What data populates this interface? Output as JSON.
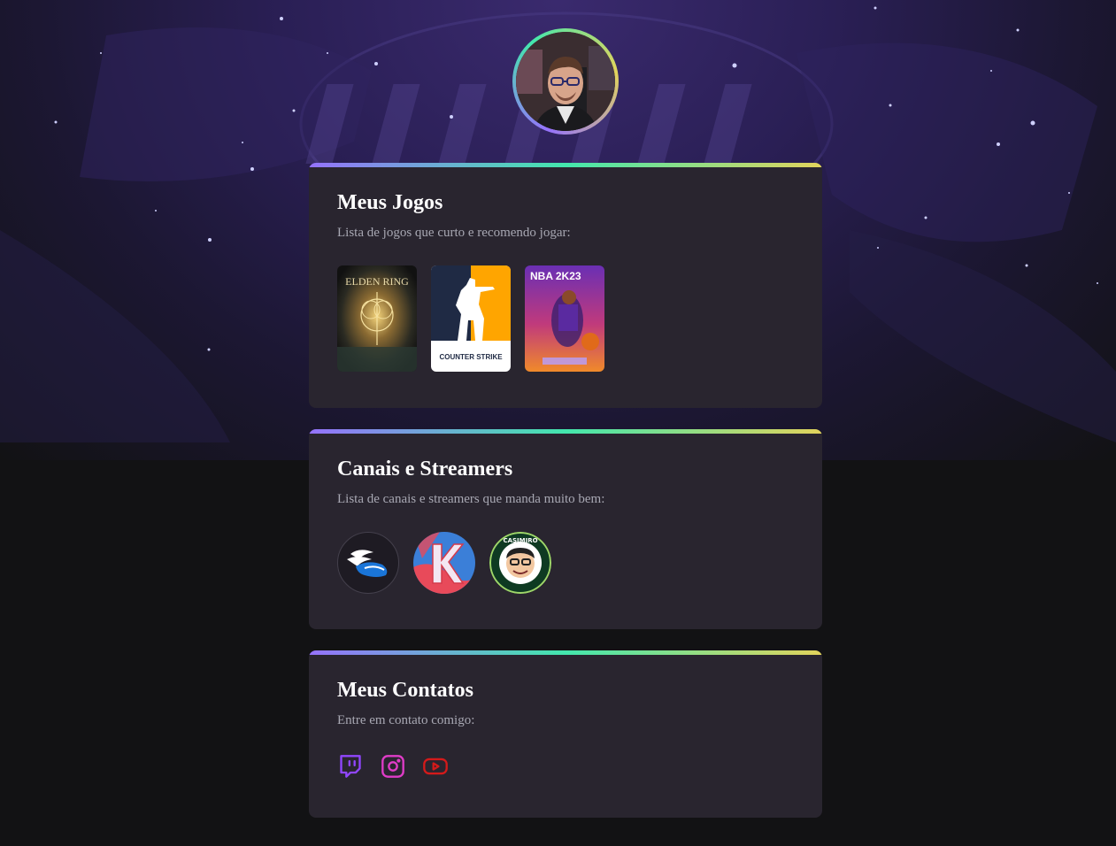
{
  "games_section": {
    "title": "Meus Jogos",
    "description": "Lista de jogos que curto e recomendo jogar:",
    "items": [
      {
        "name": "ELDEN RING"
      },
      {
        "name": "COUNTER STRIKE"
      },
      {
        "name": "NBA 2K23"
      }
    ]
  },
  "streamers_section": {
    "title": "Canais e Streamers",
    "description": "Lista de canais e streamers que manda muito bem:",
    "items": [
      {
        "name": "CASIMIRO"
      }
    ]
  },
  "contacts_section": {
    "title": "Meus Contatos",
    "description": "Entre em contato comigo:",
    "items": [
      {
        "icon": "twitch-icon",
        "color": "#9146ff"
      },
      {
        "icon": "instagram-icon",
        "color": "#e03cc8"
      },
      {
        "icon": "youtube-icon",
        "color": "#d41a1a"
      }
    ]
  },
  "colors": {
    "accent_start": "#9572fc",
    "accent_mid": "#43e7ad",
    "accent_end": "#e2d45c",
    "card_bg": "#29252f",
    "page_bg": "#121214"
  }
}
